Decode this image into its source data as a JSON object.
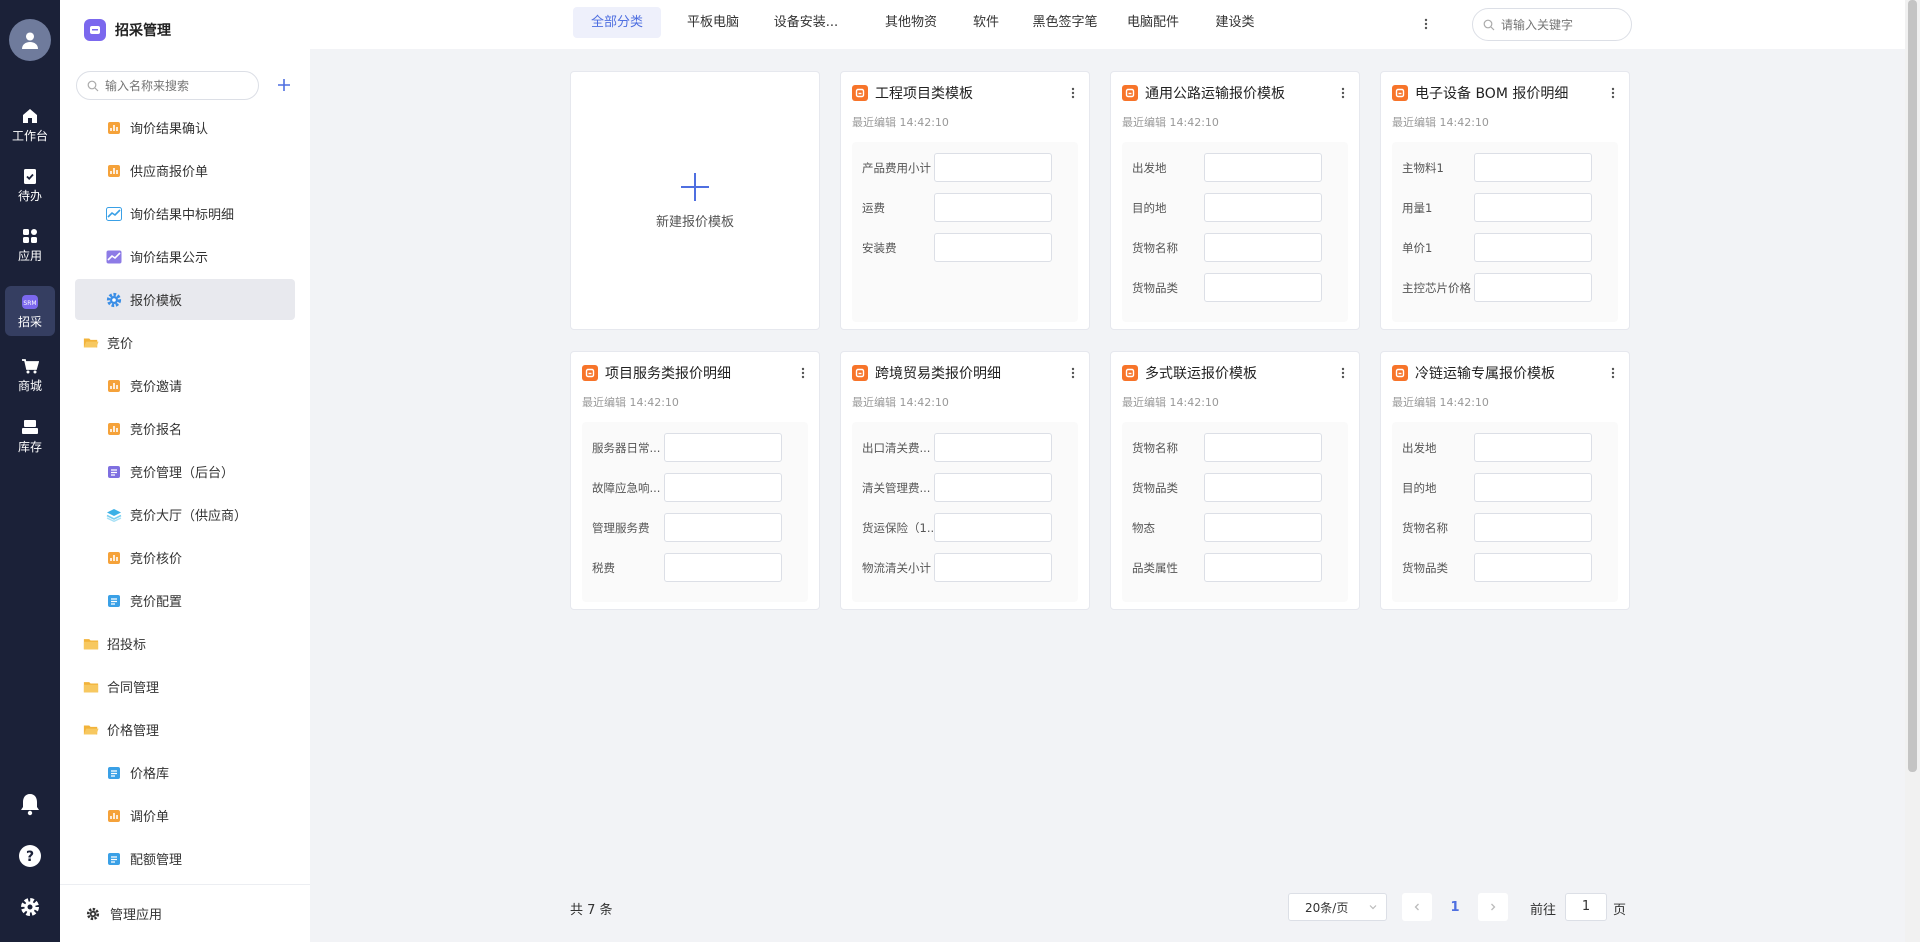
{
  "sidebar": {
    "title": "招采管理",
    "search_placeholder": "输入名称来搜索",
    "items": [
      {
        "label": "询价结果确认",
        "icon": "orange-form-icon",
        "level": 2
      },
      {
        "label": "供应商报价单",
        "icon": "orange-form-icon",
        "level": 2
      },
      {
        "label": "询价结果中标明细",
        "icon": "blue-chart-icon",
        "level": 2
      },
      {
        "label": "询价结果公示",
        "icon": "purple-chart-icon",
        "level": 2
      },
      {
        "label": "报价模板",
        "icon": "blue-gear-icon",
        "level": 2,
        "active": true
      },
      {
        "label": "竞价",
        "icon": "folder-open-icon",
        "level": 1
      },
      {
        "label": "竞价邀请",
        "icon": "orange-form-icon",
        "level": 2
      },
      {
        "label": "竞价报名",
        "icon": "orange-form-icon",
        "level": 2
      },
      {
        "label": "竞价管理（后台）",
        "icon": "purple-doc-icon",
        "level": 2
      },
      {
        "label": "竞价大厅（供应商）",
        "icon": "layers-icon",
        "level": 2
      },
      {
        "label": "竞价核价",
        "icon": "orange-form-icon",
        "level": 2
      },
      {
        "label": "竞价配置",
        "icon": "blue-doc-icon",
        "level": 2
      },
      {
        "label": "招投标",
        "icon": "folder-icon",
        "level": 1
      },
      {
        "label": "合同管理",
        "icon": "folder-icon",
        "level": 1
      },
      {
        "label": "价格管理",
        "icon": "folder-open-icon",
        "level": 1
      },
      {
        "label": "价格库",
        "icon": "blue-doc-icon",
        "level": 2
      },
      {
        "label": "调价单",
        "icon": "orange-form-icon",
        "level": 2
      },
      {
        "label": "配额管理",
        "icon": "blue-doc-icon",
        "level": 2
      }
    ],
    "footer_label": "管理应用"
  },
  "rail": {
    "items": [
      {
        "label": "工作台",
        "icon": "home-icon"
      },
      {
        "label": "待办",
        "icon": "clipboard-check-icon"
      },
      {
        "label": "应用",
        "icon": "grid-icon"
      },
      {
        "label": "招采",
        "icon": "procurement-icon",
        "active": true
      },
      {
        "label": "商城",
        "icon": "cart-icon"
      },
      {
        "label": "库存",
        "icon": "inventory-icon"
      }
    ]
  },
  "tabs": [
    "全部分类",
    "平板电脑",
    "设备安装...",
    "其他物资",
    "软件",
    "黑色签字笔",
    "电脑配件",
    "建设类"
  ],
  "search_placeholder": "请输入关键字",
  "new_template_label": "新建报价模板",
  "cards": [
    {
      "title": "工程项目类模板",
      "time": "最近编辑 14:42:10",
      "fields": [
        "产品费用小计",
        "运费",
        "安装费"
      ]
    },
    {
      "title": "通用公路运输报价模板",
      "time": "最近编辑 14:42:10",
      "fields": [
        "出发地",
        "目的地",
        "货物名称",
        "货物品类"
      ]
    },
    {
      "title": "电子设备 BOM 报价明细",
      "time": "最近编辑 14:42:10",
      "fields": [
        "主物料1",
        "用量1",
        "单价1",
        "主控芯片价格"
      ]
    },
    {
      "title": "项目服务类报价明细",
      "time": "最近编辑 14:42:10",
      "fields": [
        "服务器日常...",
        "故障应急响...",
        "管理服务费",
        "税费"
      ]
    },
    {
      "title": "跨境贸易类报价明细",
      "time": "最近编辑 14:42:10",
      "fields": [
        "出口清关费...",
        "清关管理费...",
        "货运保险（1...",
        "物流清关小计"
      ]
    },
    {
      "title": "多式联运报价模板",
      "time": "最近编辑 14:42:10",
      "fields": [
        "货物名称",
        "货物品类",
        "物态",
        "品类属性"
      ]
    },
    {
      "title": "冷链运输专属报价模板",
      "time": "最近编辑 14:42:10",
      "fields": [
        "出发地",
        "目的地",
        "货物名称",
        "货物品类"
      ]
    }
  ],
  "pagination": {
    "total": "共 7 条",
    "page_size": "20条/页",
    "current_page": "1",
    "goto_label": "前往",
    "goto_value": "1",
    "page_suffix": "页"
  },
  "colors": {
    "accent": "#4f6fe0",
    "rail_bg": "#1b2138",
    "card_icon": "#f7742a"
  }
}
